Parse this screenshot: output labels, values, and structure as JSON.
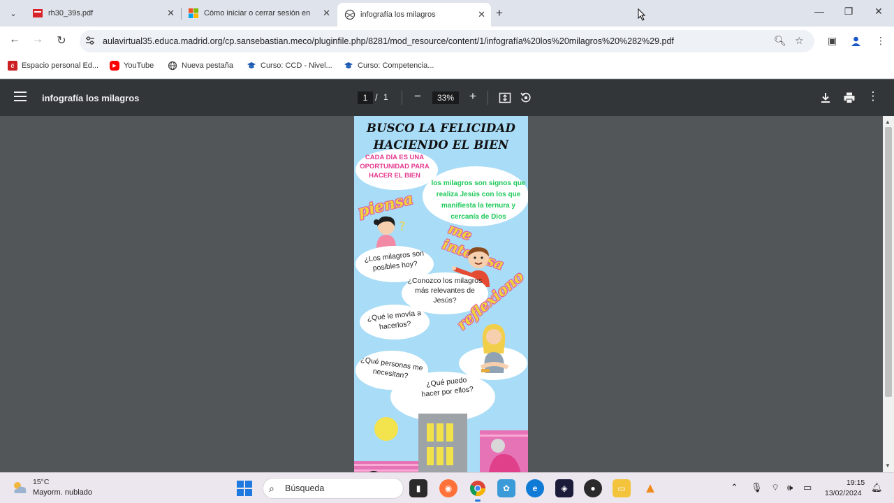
{
  "tabs": [
    {
      "title": "rh30_39s.pdf",
      "active": false
    },
    {
      "title": "Cómo iniciar o cerrar sesión en",
      "active": false
    },
    {
      "title": "infografía los milagros",
      "active": true
    }
  ],
  "url": "aulavirtual35.educa.madrid.org/cp.sansebastian.meco/pluginfile.php/8281/mod_resource/content/1/infografía%20los%20milagros%20%282%29.pdf",
  "bookmarks": [
    {
      "label": "Espacio personal Ed..."
    },
    {
      "label": "YouTube"
    },
    {
      "label": "Nueva pestaña"
    },
    {
      "label": "Curso: CCD - Nivel..."
    },
    {
      "label": "Curso: Competencia..."
    }
  ],
  "pdf": {
    "title": "infografía los milagros",
    "page_current": "1",
    "page_sep": "/",
    "page_total": "1",
    "zoom": "33%"
  },
  "infographic": {
    "title_line1": "BUSCO LA FELICIDAD",
    "title_line2": "HACIENDO EL BIEN",
    "daily": "CADA DÍA ES UNA OPORTUNIDAD PARA HACER EL BIEN",
    "definition": "los milagros son signos que realiza Jesús con los que manifiesta la ternura y cercanía de Dios",
    "word_piensa": "piensa",
    "word_interesa": "me interesa",
    "word_reflexiono": "reflexiono",
    "q1": "¿Los milagros son posibles hoy?",
    "q2": "¿Conozco los milagros más relevantes de Jesús?",
    "q3": "¿Qué le movía a hacerlos?",
    "q4": "¿Qué personas me necesitan?",
    "q5": "¿Qué puedo hacer por ellos?"
  },
  "taskbar": {
    "temperature": "15°C",
    "weather": "Mayorm. nublado",
    "search_placeholder": "Búsqueda",
    "time": "19:15",
    "date": "13/02/2024"
  },
  "colors": {
    "accent": "#1f7ae0",
    "pdf_toolbar": "#323639",
    "viewer_bg": "#525659",
    "page_bg": "#a9dcf6"
  }
}
